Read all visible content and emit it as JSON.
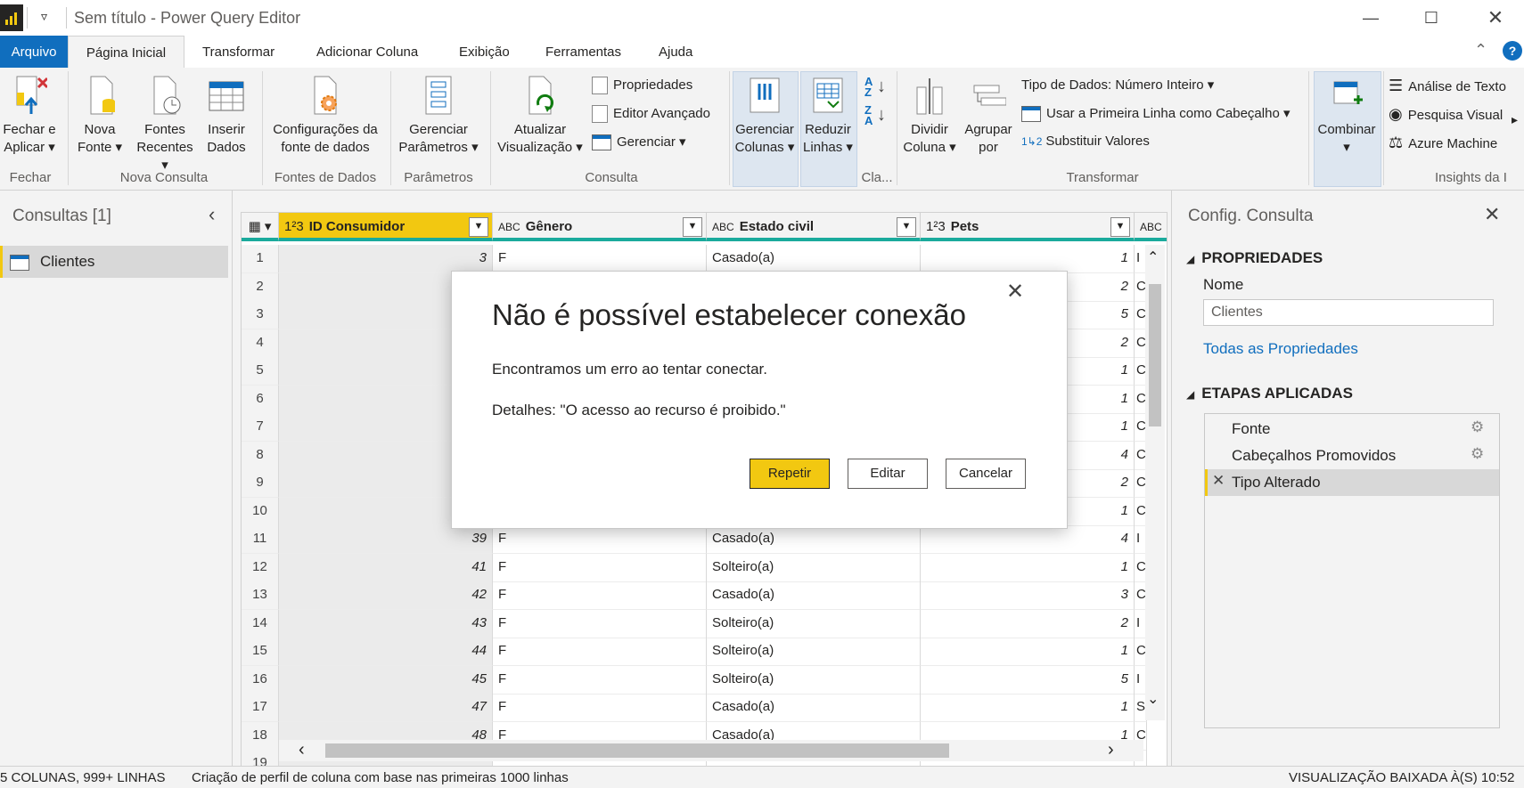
{
  "window": {
    "title": "Sem título - Power Query Editor",
    "minimize_icon": "minimize-icon",
    "maximize_icon": "maximize-icon",
    "close_icon": "close-icon"
  },
  "tabs": [
    {
      "label": "Arquivo"
    },
    {
      "label": "Página Inicial"
    },
    {
      "label": "Transformar"
    },
    {
      "label": "Adicionar Coluna"
    },
    {
      "label": "Exibição"
    },
    {
      "label": "Ferramentas"
    },
    {
      "label": "Ajuda"
    }
  ],
  "ribbon": {
    "fechar_aplicar": [
      "Fechar e",
      "Aplicar"
    ],
    "nova_fonte": [
      "Nova",
      "Fonte"
    ],
    "fontes_recentes": [
      "Fontes",
      "Recentes"
    ],
    "inserir_dados": [
      "Inserir",
      "Dados"
    ],
    "config_fonte": [
      "Configurações da",
      "fonte de dados"
    ],
    "gerenciar_parametros": [
      "Gerenciar",
      "Parâmetros"
    ],
    "atualizar": [
      "Atualizar",
      "Visualização"
    ],
    "propriedades": "Propriedades",
    "editor_avancado": "Editor Avançado",
    "gerenciar": "Gerenciar",
    "gerenciar_colunas": [
      "Gerenciar",
      "Colunas"
    ],
    "reduzir_linhas": [
      "Reduzir",
      "Linhas"
    ],
    "dividir_coluna": [
      "Dividir",
      "Coluna"
    ],
    "agrupar_por": [
      "Agrupar",
      "por"
    ],
    "tipo_dados": "Tipo de Dados: Número Inteiro",
    "primeira_linha": "Usar a Primeira Linha como Cabeçalho",
    "substituir": "Substituir Valores",
    "combinar": "Combinar",
    "analise_texto": "Análise de Texto",
    "pesquisa_visual": "Pesquisa Visual",
    "azure_machine": "Azure Machine",
    "groups": {
      "fechar": "Fechar",
      "nova_consulta": "Nova Consulta",
      "fontes_dados": "Fontes de Dados",
      "parametros": "Parâmetros",
      "consulta": "Consulta",
      "classificar": "Cla...",
      "transformar": "Transformar",
      "insights": "Insights da I"
    },
    "sort_labels": {
      "asc_top": "A",
      "asc_bottom": "Z",
      "desc_top": "Z",
      "desc_bottom": "A"
    }
  },
  "queries": {
    "title": "Consultas [1]",
    "items": [
      {
        "label": "Clientes"
      }
    ]
  },
  "grid": {
    "columns": [
      {
        "type": "1²3",
        "name": "ID Consumidor"
      },
      {
        "type": "ABC",
        "name": "Gênero"
      },
      {
        "type": "ABC",
        "name": "Estado civil"
      },
      {
        "type": "1²3",
        "name": "Pets"
      },
      {
        "type": "ABC",
        "name": ""
      }
    ],
    "rows": [
      {
        "n": "1",
        "id": "3",
        "g": "F",
        "e": "Casado(a)",
        "p": "1",
        "x": "I"
      },
      {
        "n": "2",
        "id": "",
        "g": "",
        "e": "",
        "p": "2",
        "x": "C"
      },
      {
        "n": "3",
        "id": "",
        "g": "",
        "e": "",
        "p": "5",
        "x": "C"
      },
      {
        "n": "4",
        "id": "",
        "g": "",
        "e": "",
        "p": "2",
        "x": "C"
      },
      {
        "n": "5",
        "id": "",
        "g": "",
        "e": "",
        "p": "1",
        "x": "C"
      },
      {
        "n": "6",
        "id": "",
        "g": "",
        "e": "",
        "p": "1",
        "x": "C"
      },
      {
        "n": "7",
        "id": "",
        "g": "",
        "e": "",
        "p": "1",
        "x": "C"
      },
      {
        "n": "8",
        "id": "",
        "g": "",
        "e": "",
        "p": "4",
        "x": "C"
      },
      {
        "n": "9",
        "id": "",
        "g": "",
        "e": "",
        "p": "2",
        "x": "C"
      },
      {
        "n": "10",
        "id": "",
        "g": "",
        "e": "",
        "p": "1",
        "x": "C"
      },
      {
        "n": "11",
        "id": "39",
        "g": "F",
        "e": "Casado(a)",
        "p": "4",
        "x": "I"
      },
      {
        "n": "12",
        "id": "41",
        "g": "F",
        "e": "Solteiro(a)",
        "p": "1",
        "x": "C"
      },
      {
        "n": "13",
        "id": "42",
        "g": "F",
        "e": "Casado(a)",
        "p": "3",
        "x": "C"
      },
      {
        "n": "14",
        "id": "43",
        "g": "F",
        "e": "Solteiro(a)",
        "p": "2",
        "x": "I"
      },
      {
        "n": "15",
        "id": "44",
        "g": "F",
        "e": "Solteiro(a)",
        "p": "1",
        "x": "C"
      },
      {
        "n": "16",
        "id": "45",
        "g": "F",
        "e": "Solteiro(a)",
        "p": "5",
        "x": "I"
      },
      {
        "n": "17",
        "id": "47",
        "g": "F",
        "e": "Casado(a)",
        "p": "1",
        "x": "S"
      },
      {
        "n": "18",
        "id": "48",
        "g": "F",
        "e": "Casado(a)",
        "p": "1",
        "x": "C"
      },
      {
        "n": "19",
        "id": "",
        "g": "",
        "e": "",
        "p": "",
        "x": ""
      }
    ]
  },
  "settings": {
    "title": "Config. Consulta",
    "propriedades": "PROPRIEDADES",
    "nome_label": "Nome",
    "nome_value": "Clientes",
    "todas_props": "Todas as Propriedades",
    "etapas": "ETAPAS APLICADAS",
    "steps": [
      {
        "label": "Fonte"
      },
      {
        "label": "Cabeçalhos Promovidos"
      },
      {
        "label": "Tipo Alterado"
      }
    ]
  },
  "status": {
    "left": "5 COLUNAS, 999+ LINHAS",
    "middle": "Criação de perfil de coluna com base nas primeiras 1000 linhas",
    "right": "VISUALIZAÇÃO BAIXADA À(S) 10:52"
  },
  "dialog": {
    "title": "Não é possível estabelecer conexão",
    "message": "Encontramos um erro ao tentar conectar.",
    "details": "Detalhes: \"O acesso ao recurso é proibido.\"",
    "retry": "Repetir",
    "edit": "Editar",
    "cancel": "Cancelar"
  },
  "colors": {
    "accent_yellow": "#f2c811",
    "file_tab_blue": "#106ebe",
    "column_quality_bar": "#1aaa9c",
    "link_blue": "#106ebe"
  }
}
